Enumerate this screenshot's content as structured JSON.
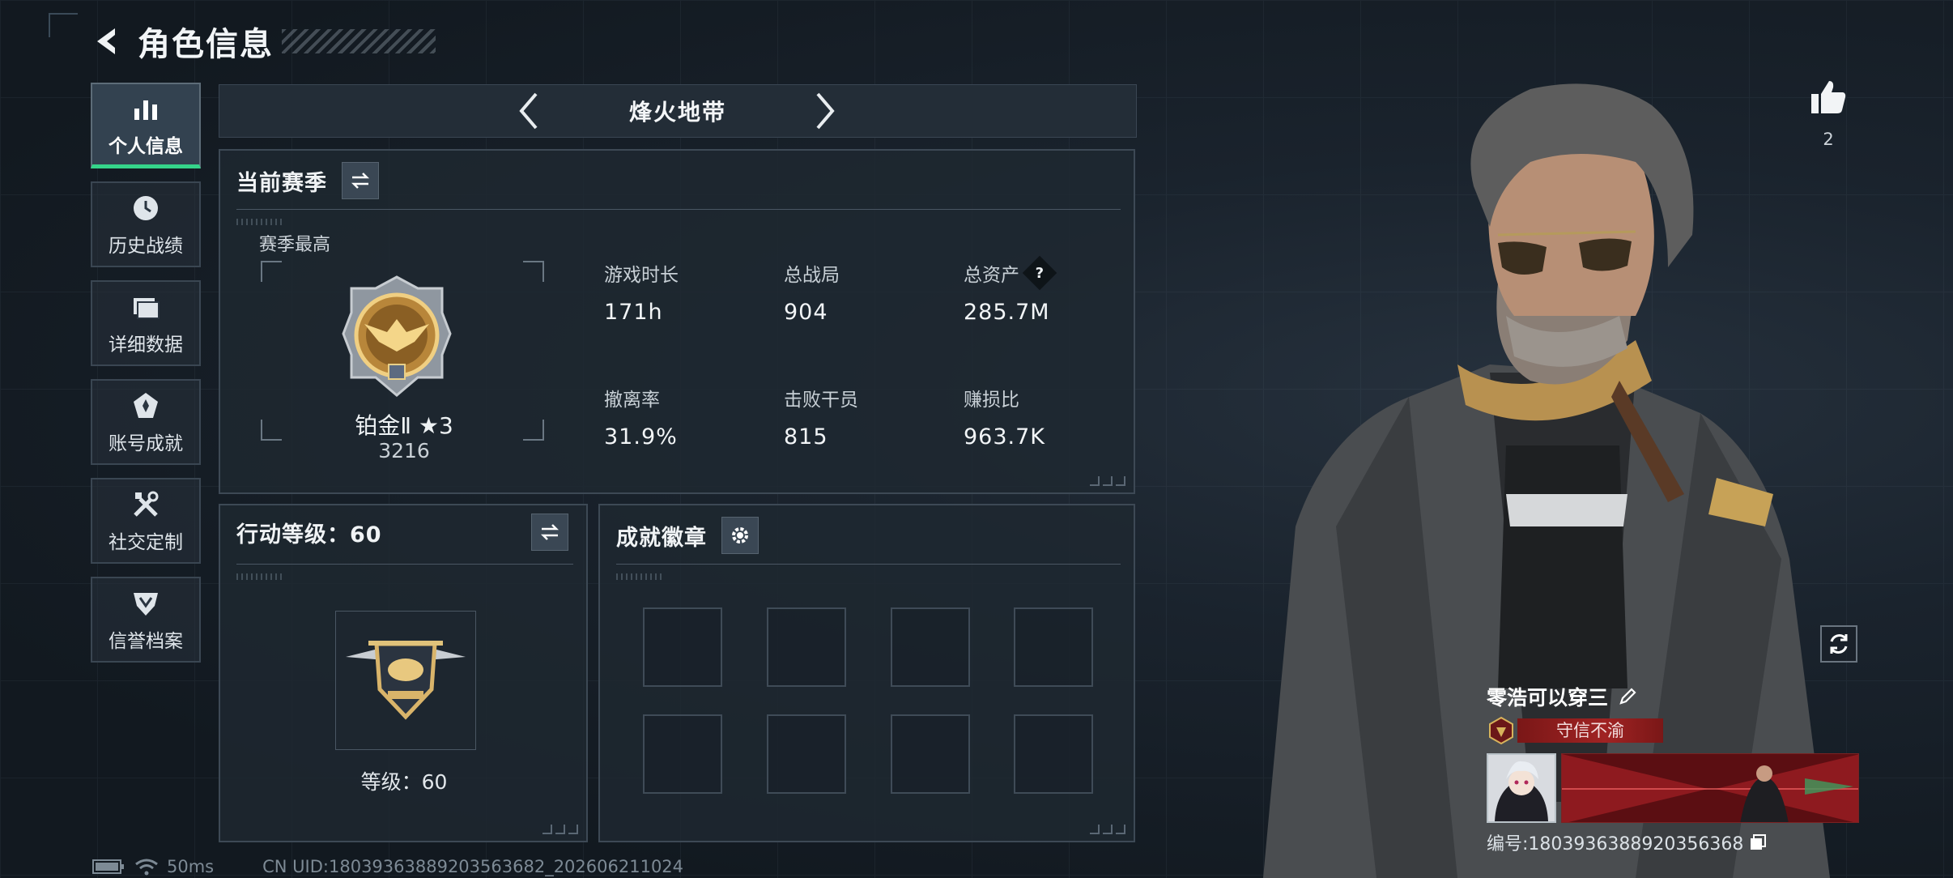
{
  "header": {
    "title": "角色信息"
  },
  "nav": {
    "items": [
      {
        "label": "个人信息",
        "icon": "bar-chart-icon",
        "active": true
      },
      {
        "label": "历史战绩",
        "icon": "history-icon",
        "active": false
      },
      {
        "label": "详细数据",
        "icon": "folder-icon",
        "active": false
      },
      {
        "label": "账号成就",
        "icon": "achievement-icon",
        "active": false
      },
      {
        "label": "社交定制",
        "icon": "tools-icon",
        "active": false
      },
      {
        "label": "信誉档案",
        "icon": "credit-shield-icon",
        "active": false
      }
    ]
  },
  "mode": {
    "name": "烽火地带"
  },
  "season": {
    "title": "当前赛季",
    "best_label": "赛季最高",
    "rank_name": "铂金Ⅱ ★3",
    "rank_score": "3216",
    "stats": [
      {
        "label": "游戏时长",
        "value": "171h"
      },
      {
        "label": "总战局",
        "value": "904"
      },
      {
        "label": "总资产",
        "value": "285.7M",
        "help": "?"
      },
      {
        "label": "撤离率",
        "value": "31.9%"
      },
      {
        "label": "击败干员",
        "value": "815"
      },
      {
        "label": "赚损比",
        "value": "963.7K"
      }
    ]
  },
  "action_level": {
    "title": "行动等级：60",
    "level_text": "等级：60"
  },
  "achievements": {
    "title": "成就徽章",
    "slot_count": 8
  },
  "like": {
    "count": "2"
  },
  "profile": {
    "name": "零浩可以穿三",
    "title_tag": "守信不渝",
    "id_text": "编号:1803936388920356368"
  },
  "footer": {
    "latency": "50ms",
    "uid": "CN UID:1803936388920356368​2_202606211024"
  },
  "colors": {
    "accent": "#35d48a",
    "tag_red": "#a02323",
    "gold": "#c9a25a"
  }
}
